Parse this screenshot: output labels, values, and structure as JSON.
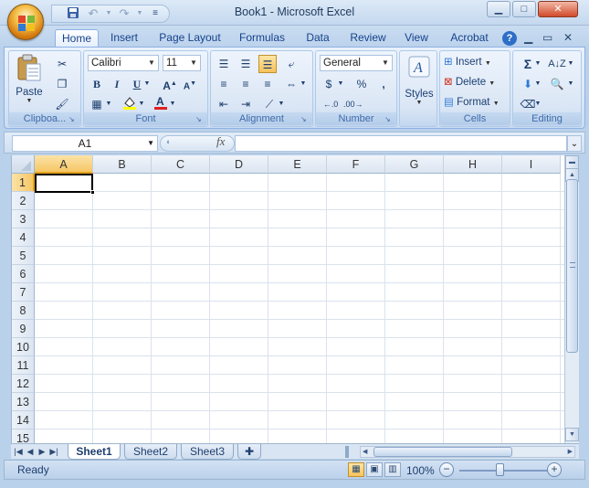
{
  "window": {
    "title": "Book1 - Microsoft Excel",
    "controls": [
      "minimize",
      "maximize",
      "close"
    ]
  },
  "quick_access": {
    "icons": [
      "save-icon",
      "undo-icon",
      "redo-icon",
      "customize-icon"
    ]
  },
  "ribbon": {
    "tabs": [
      {
        "label": "Home",
        "active": true
      },
      {
        "label": "Insert"
      },
      {
        "label": "Page Layout"
      },
      {
        "label": "Formulas"
      },
      {
        "label": "Data"
      },
      {
        "label": "Review"
      },
      {
        "label": "View"
      },
      {
        "label": "Acrobat"
      }
    ],
    "clipboard": {
      "label": "Clipboa...",
      "paste": "Paste"
    },
    "font": {
      "label": "Font",
      "name": "Calibri",
      "size": "11"
    },
    "alignment": {
      "label": "Alignment"
    },
    "number": {
      "label": "Number",
      "format": "General"
    },
    "styles": {
      "label": "Styles"
    },
    "cells": {
      "label": "Cells",
      "insert": "Insert",
      "delete": "Delete",
      "format": "Format"
    },
    "editing": {
      "label": "Editing"
    }
  },
  "formula_bar": {
    "name_box": "A1",
    "fx": "fx",
    "formula": ""
  },
  "sheet": {
    "columns": [
      "A",
      "B",
      "C",
      "D",
      "E",
      "F",
      "G",
      "H",
      "I"
    ],
    "rows": [
      "1",
      "2",
      "3",
      "4",
      "5",
      "6",
      "7",
      "8",
      "9",
      "10",
      "11",
      "12",
      "13",
      "14",
      "15"
    ],
    "active_cell": "A1"
  },
  "sheet_tabs": [
    {
      "label": "Sheet1",
      "active": true
    },
    {
      "label": "Sheet2"
    },
    {
      "label": "Sheet3"
    }
  ],
  "status_bar": {
    "status": "Ready",
    "zoom": "100%"
  },
  "colors": {
    "accent": "#15428b",
    "selection_header": "#f6c765",
    "ribbon_bg": "#dbe7f6"
  }
}
